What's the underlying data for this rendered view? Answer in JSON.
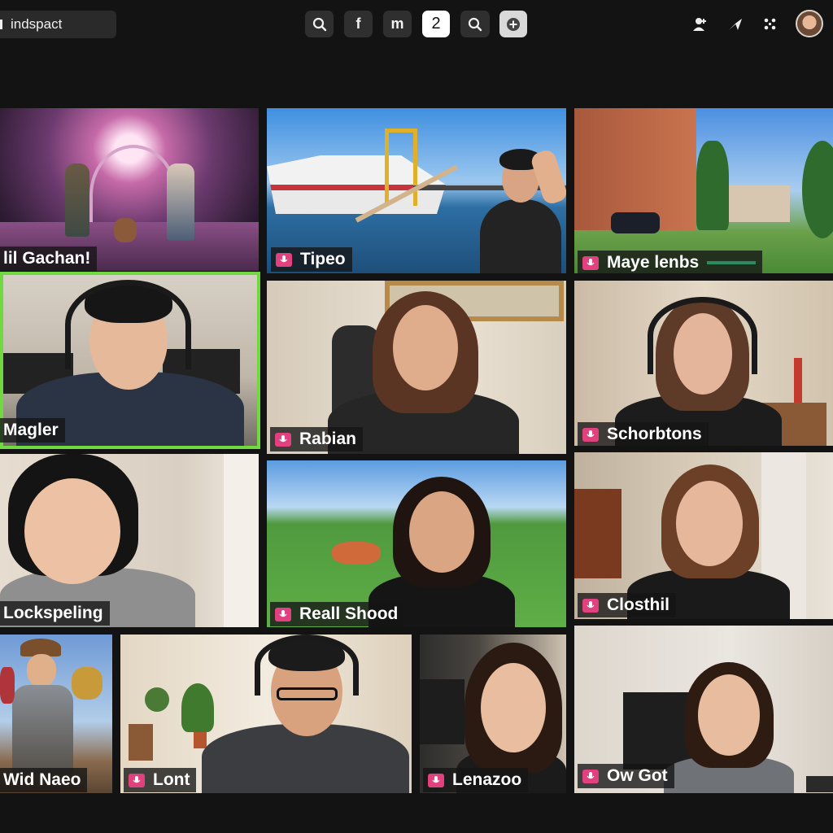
{
  "workspace": {
    "name": "indspact"
  },
  "toolbar": {
    "buttons": [
      {
        "name": "search-button",
        "icon": "search-icon",
        "glyph": "⌕"
      },
      {
        "name": "facebook-button",
        "icon": "facebook-icon",
        "glyph": "f"
      },
      {
        "name": "m-button",
        "icon": "m-icon",
        "glyph": "m"
      },
      {
        "name": "page-two-button",
        "icon": "number-icon",
        "glyph": "2"
      },
      {
        "name": "search-secondary-button",
        "icon": "search-icon",
        "glyph": "⌕"
      },
      {
        "name": "add-button",
        "icon": "plus-circle-icon",
        "glyph": "+"
      }
    ]
  },
  "header_right": {
    "icons": [
      "add-person-icon",
      "send-icon",
      "grid-icon",
      "user-avatar"
    ]
  },
  "participants": [
    {
      "name": "lil Gachan!",
      "mic": false
    },
    {
      "name": "Tipeo",
      "mic": true
    },
    {
      "name": "Maye lenbs",
      "mic": true
    },
    {
      "name": "Magler",
      "mic": false,
      "speaking": true
    },
    {
      "name": "Rabian",
      "mic": true
    },
    {
      "name": "Schorbtons",
      "mic": true
    },
    {
      "name": "Lockspeling",
      "mic": false
    },
    {
      "name": "Reall Shood",
      "mic": true
    },
    {
      "name": "Closthil",
      "mic": true
    },
    {
      "name": "Wid Naeo",
      "mic": false
    },
    {
      "name": "Lont",
      "mic": true
    },
    {
      "name": "Lenazoo",
      "mic": true
    },
    {
      "name": "Ow Got",
      "mic": true
    }
  ],
  "colors": {
    "background": "#131313",
    "speaking_border": "#6fd93f",
    "mic_badge": "#e2417f"
  }
}
